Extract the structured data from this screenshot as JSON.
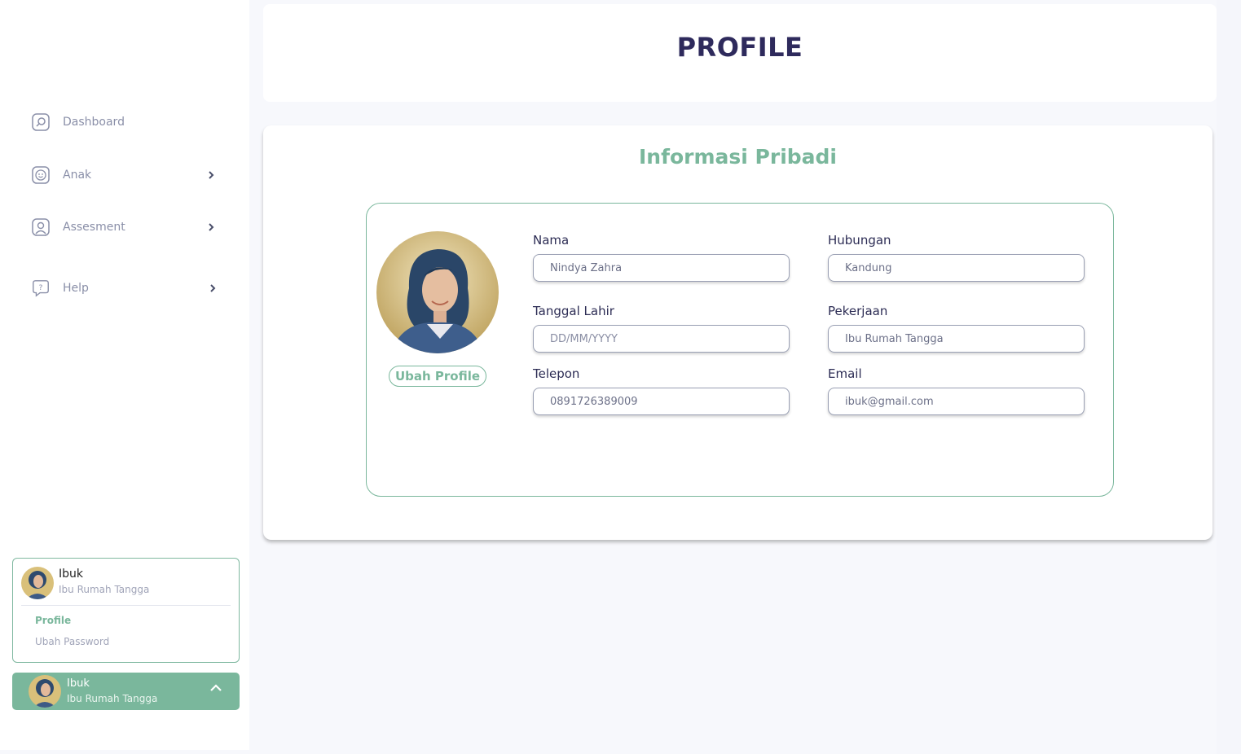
{
  "sidebar": {
    "nav": [
      {
        "label": "Dashboard",
        "icon": "dashboard-icon",
        "has_chevron": false
      },
      {
        "label": "Anak",
        "icon": "child-face-icon",
        "has_chevron": true
      },
      {
        "label": "Assesment",
        "icon": "user-portrait-icon",
        "has_chevron": true
      },
      {
        "label": "Help",
        "icon": "help-bubble-icon",
        "has_chevron": true
      }
    ],
    "user_menu": {
      "name": "Ibuk",
      "role": "Ibu Rumah Tangga",
      "links": [
        "Profile",
        "Ubah Password"
      ]
    },
    "user_bar": {
      "name": "Ibuk",
      "role": "Ibu Rumah Tangga"
    }
  },
  "header": {
    "title": "PROFILE"
  },
  "info": {
    "title": "Informasi Pribadi",
    "change_button": "Ubah Profile",
    "fields": {
      "nama": {
        "label": "Nama",
        "value": "Nindya Zahra"
      },
      "hubungan": {
        "label": "Hubungan",
        "value": "Kandung"
      },
      "tanggal_lahir": {
        "label": "Tanggal Lahir",
        "placeholder": "DD/MM/YYYY"
      },
      "pekerjaan": {
        "label": "Pekerjaan",
        "value": "Ibu Rumah Tangga"
      },
      "telepon": {
        "label": "Telepon",
        "value": "0891726389009"
      },
      "email": {
        "label": "Email",
        "value": "ibuk@gmail.com"
      }
    }
  },
  "colors": {
    "accent": "#7ab79c",
    "title": "#2e2a5c",
    "muted": "#8a8fa8"
  }
}
